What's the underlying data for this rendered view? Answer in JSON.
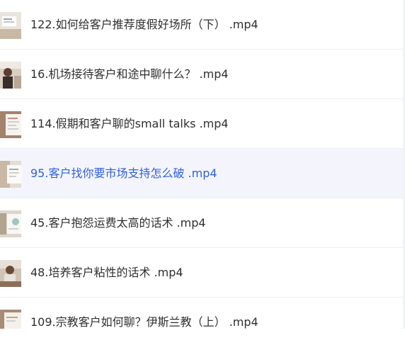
{
  "video_list": {
    "items": [
      {
        "title": "122.如何给客户推荐度假好场所（下） .mp4",
        "thumbnail": "slide-thumbnail",
        "active": false
      },
      {
        "title": "16.机场接待客户和途中聊什么？ .mp4",
        "thumbnail": "presenter-thumbnail",
        "active": false
      },
      {
        "title": "114.假期和客户聊的small talks .mp4",
        "thumbnail": "slide-thumbnail",
        "active": false
      },
      {
        "title": "95.客户找你要市场支持怎么破 .mp4",
        "thumbnail": "slide-thumbnail",
        "active": true
      },
      {
        "title": "45.客户抱怨运费太高的话术 .mp4",
        "thumbnail": "slide-thumbnail",
        "active": false
      },
      {
        "title": "48.培养客户粘性的话术 .mp4",
        "thumbnail": "presenter-thumbnail",
        "active": false
      },
      {
        "title": "109.宗教客户如何聊？伊斯兰教（上） .mp4",
        "thumbnail": "slide-thumbnail",
        "active": false
      }
    ]
  },
  "colors": {
    "active_text": "#2f5fe0",
    "active_background": "#f4f5fc",
    "text": "#2f2f2f",
    "divider": "#eceef1"
  }
}
